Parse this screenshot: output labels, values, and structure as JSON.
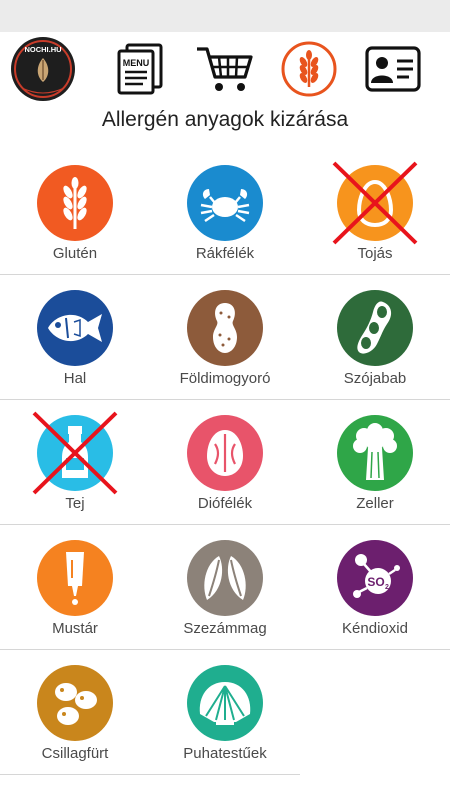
{
  "header": {
    "logo_text": "NOCHI.HU",
    "nav": [
      {
        "name": "menu-icon",
        "label": "MENU"
      },
      {
        "name": "cart-icon"
      },
      {
        "name": "allergen-icon",
        "color": "#e8541e"
      },
      {
        "name": "profile-card-icon"
      }
    ]
  },
  "page": {
    "title": "Allergén anyagok kizárása"
  },
  "allergens": [
    {
      "label": "Glutén",
      "color": "#f15a22",
      "icon": "wheat-icon",
      "excluded": false
    },
    {
      "label": "Rákfélék",
      "color": "#1a8bcf",
      "icon": "crab-icon",
      "excluded": false
    },
    {
      "label": "Tojás",
      "color": "#f7941d",
      "icon": "egg-icon",
      "excluded": true
    },
    {
      "label": "Hal",
      "color": "#1b4d9a",
      "icon": "fish-icon",
      "excluded": false
    },
    {
      "label": "Földimogyoró",
      "color": "#8d5b3b",
      "icon": "peanut-icon",
      "excluded": false
    },
    {
      "label": "Szójabab",
      "color": "#2e6b3a",
      "icon": "soybean-icon",
      "excluded": false
    },
    {
      "label": "Tej",
      "color": "#29bde6",
      "icon": "milk-bottle-icon",
      "excluded": true
    },
    {
      "label": "Diófélék",
      "color": "#e8546a",
      "icon": "nut-icon",
      "excluded": false
    },
    {
      "label": "Zeller",
      "color": "#2fa648",
      "icon": "celery-icon",
      "excluded": false
    },
    {
      "label": "Mustár",
      "color": "#f58220",
      "icon": "mustard-icon",
      "excluded": false
    },
    {
      "label": "Szezámmag",
      "color": "#8c8279",
      "icon": "sesame-icon",
      "excluded": false
    },
    {
      "label": "Kéndioxid",
      "color": "#6c1f6e",
      "icon": "sulphur-dioxide-icon",
      "excluded": false
    },
    {
      "label": "Csillagfürt",
      "color": "#c9861c",
      "icon": "lupin-icon",
      "excluded": false
    },
    {
      "label": "Puhatestűek",
      "color": "#1fae8f",
      "icon": "shell-icon",
      "excluded": false
    }
  ]
}
